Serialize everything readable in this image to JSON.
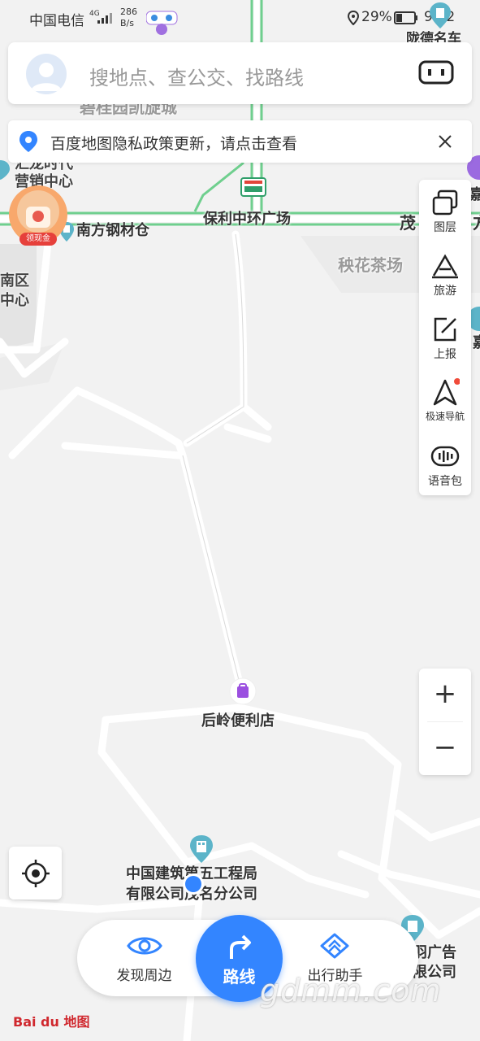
{
  "status_bar": {
    "carrier": "中国电信",
    "network": "4G",
    "speed": "286 B/s",
    "battery": "29%",
    "time": "9:12"
  },
  "search": {
    "placeholder": "搜地点、查公交、找路线"
  },
  "notice": {
    "text": "百度地图隐私政策更新，请点击查看"
  },
  "promo": {
    "badge": "领现金"
  },
  "map_labels": {
    "top_right": "陇德名车",
    "tower": "碧桂园凯旋城",
    "huilong1": "汇龙时代",
    "huilong2": "营销中心",
    "poli": "保利中环广场",
    "nanfang": "南方钢材仓",
    "mao": "茂",
    "mao2": "方",
    "yanghua": "秧花茶场",
    "nanqu1": "南区",
    "nanqu2": "中心",
    "xiu": "嘉",
    "store": "后岭便利店",
    "zhongjian1": "中国建筑第五工程局",
    "zhongjian2": "有限公司茂名分公司",
    "chuangyu1": "创羽广告",
    "chuangyu2": "有限公司"
  },
  "tools": [
    {
      "label": "图层",
      "icon": "layers-icon"
    },
    {
      "label": "旅游",
      "icon": "travel-icon"
    },
    {
      "label": "上报",
      "icon": "report-icon"
    },
    {
      "label": "极速导航",
      "icon": "navigation-icon"
    },
    {
      "label": "语音包",
      "icon": "voice-pack-icon"
    }
  ],
  "zoom": {
    "in": "+",
    "out": "−"
  },
  "bottom": {
    "discover": "发现周边",
    "route": "路线",
    "assistant": "出行助手"
  },
  "brand": {
    "logo": "Bai du 地图"
  },
  "watermark": "gdmm.com",
  "colors": {
    "primary": "#3385ff",
    "road_green": "#6fcf8e",
    "map_bg": "#f2f2f2"
  }
}
